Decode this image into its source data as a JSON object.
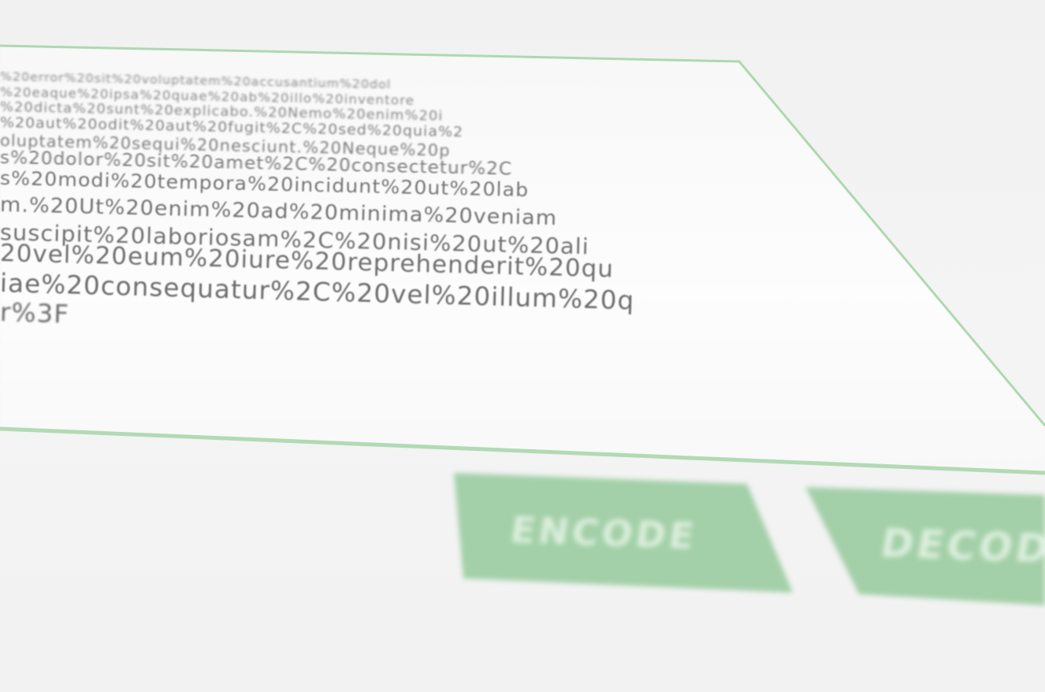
{
  "text_area": {
    "lines": [
      "%20error%20sit%20voluptatem%20accusantium%20dol",
      "%20eaque%20ipsa%20quae%20ab%20illo%20inventore",
      "%20dicta%20sunt%20explicabo.%20Nemo%20enim%20i",
      "%20aut%20odit%20aut%20fugit%2C%20sed%20quia%2",
      "oluptatem%20sequi%20nesciunt.%20Neque%20p",
      "s%20dolor%20sit%20amet%2C%20consectetur%2C",
      "s%20modi%20tempora%20incidunt%20ut%20lab",
      "m.%20Ut%20enim%20ad%20minima%20veniam",
      "suscipit%20laboriosam%2C%20nisi%20ut%20ali",
      "20vel%20eum%20iure%20reprehenderit%20qu",
      "iae%20consequatur%2C%20vel%20illum%20q",
      "r%3F"
    ],
    "border_color": "#a6d5a8",
    "text_color": "#6e6e6e"
  },
  "buttons": {
    "encode_label": "ENCODE",
    "decode_label": "DECODE",
    "color": "#a3d0a8"
  }
}
